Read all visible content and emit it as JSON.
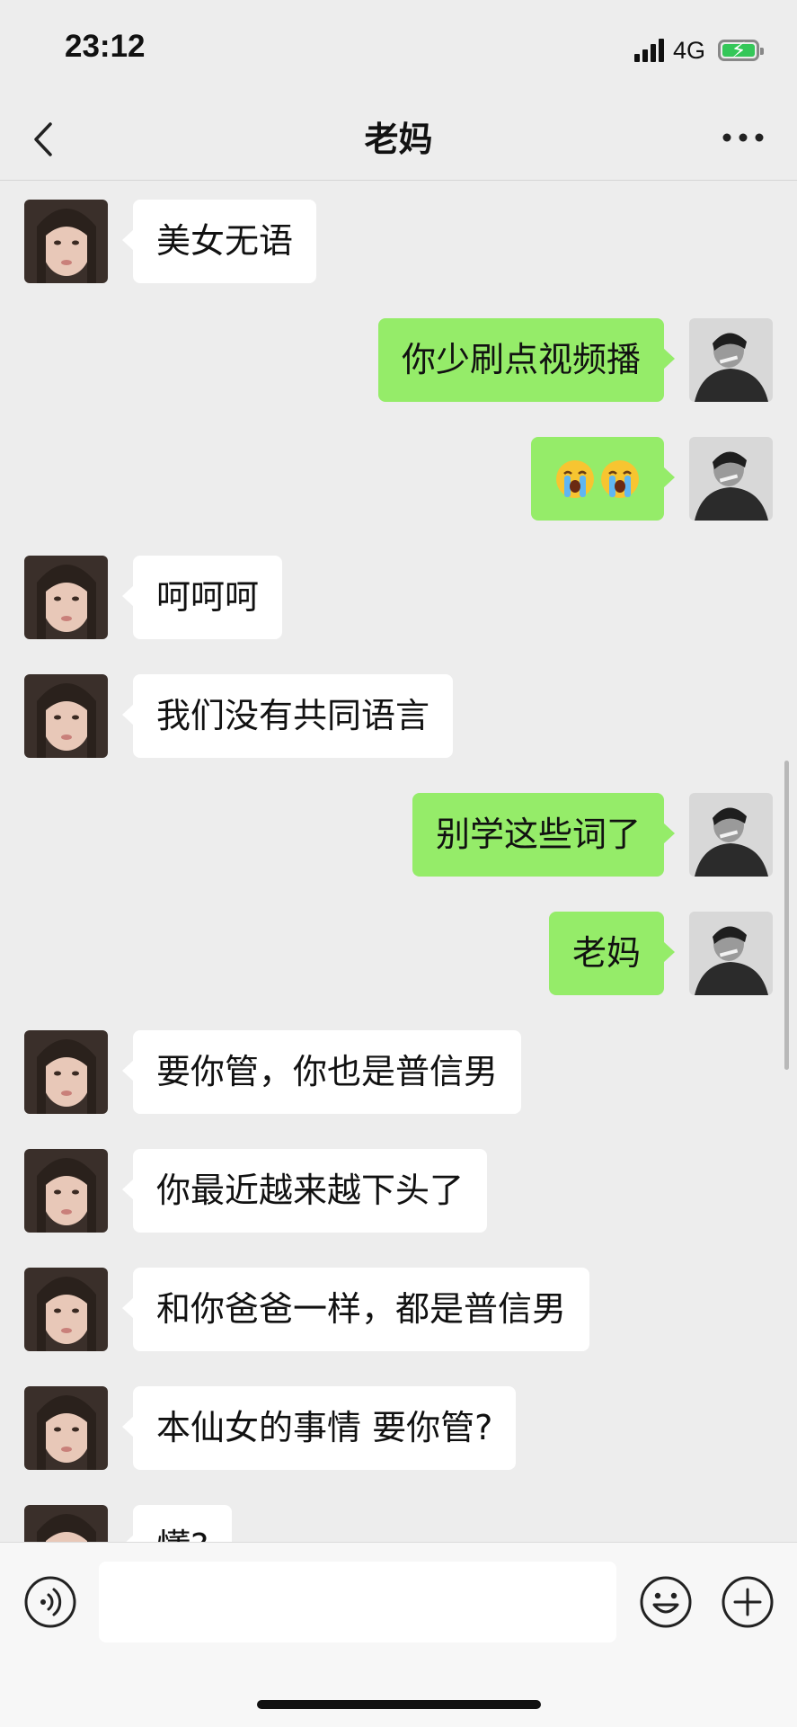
{
  "status_bar": {
    "time": "23:12",
    "network": "4G",
    "battery_color": "#35c759",
    "battery_icon": "charging-bolt"
  },
  "nav": {
    "title": "老妈",
    "back_icon": "chevron-left-icon",
    "more_icon": "ellipsis-icon"
  },
  "colors": {
    "background": "#ededed",
    "incoming_bubble": "#ffffff",
    "outgoing_bubble": "#95ec69"
  },
  "messages": [
    {
      "side": "left",
      "sender": "mom",
      "text": "美女无语"
    },
    {
      "side": "right",
      "sender": "me",
      "text": "你少刷点视频播"
    },
    {
      "side": "right",
      "sender": "me",
      "text": "",
      "emoji": [
        "loudly-crying-face",
        "loudly-crying-face"
      ]
    },
    {
      "side": "left",
      "sender": "mom",
      "text": "呵呵呵"
    },
    {
      "side": "left",
      "sender": "mom",
      "text": "我们没有共同语言"
    },
    {
      "side": "right",
      "sender": "me",
      "text": "别学这些词了"
    },
    {
      "side": "right",
      "sender": "me",
      "text": "老妈"
    },
    {
      "side": "left",
      "sender": "mom",
      "text": "要你管，你也是普信男"
    },
    {
      "side": "left",
      "sender": "mom",
      "text": "你最近越来越下头了"
    },
    {
      "side": "left",
      "sender": "mom",
      "text": "和你爸爸一样，都是普信男"
    },
    {
      "side": "left",
      "sender": "mom",
      "text": "本仙女的事情 要你管?"
    },
    {
      "side": "left",
      "sender": "mom",
      "text": "懂?"
    }
  ],
  "input_bar": {
    "voice_icon": "voice-icon",
    "input_value": "",
    "emoji_icon": "smiley-icon",
    "plus_icon": "plus-icon"
  }
}
